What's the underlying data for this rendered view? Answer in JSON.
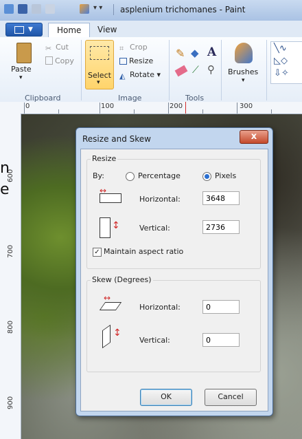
{
  "window": {
    "title": "asplenium trichomanes - Paint"
  },
  "tabs": [
    {
      "label": "Home"
    },
    {
      "label": "View"
    }
  ],
  "ribbon": {
    "clipboard": {
      "paste": "Paste",
      "cut": "Cut",
      "copy": "Copy",
      "label": "Clipboard"
    },
    "image": {
      "select": "Select",
      "crop": "Crop",
      "resize": "Resize",
      "rotate": "Rotate",
      "label": "Image"
    },
    "tools": {
      "label": "Tools"
    },
    "brushes": {
      "label": "Brushes"
    }
  },
  "ruler": {
    "h": [
      "0",
      "100",
      "200",
      "300"
    ],
    "v": [
      "600",
      "700",
      "800",
      "900"
    ]
  },
  "behind_text": [
    "n",
    "e"
  ],
  "dialog": {
    "title": "Resize and Skew",
    "close_glyph": "x",
    "resize": {
      "legend": "Resize",
      "by_label": "By:",
      "percentage_label": "Percentage",
      "pixels_label": "Pixels",
      "selected": "Pixels",
      "horizontal_label": "Horizontal:",
      "horizontal_value": "3648",
      "vertical_label": "Vertical:",
      "vertical_value": "2736",
      "maintain_label": "Maintain aspect ratio",
      "maintain_checked": true
    },
    "skew": {
      "legend": "Skew (Degrees)",
      "horizontal_label": "Horizontal:",
      "horizontal_value": "0",
      "vertical_label": "Vertical:",
      "vertical_value": "0"
    },
    "ok_label": "OK",
    "cancel_label": "Cancel"
  }
}
